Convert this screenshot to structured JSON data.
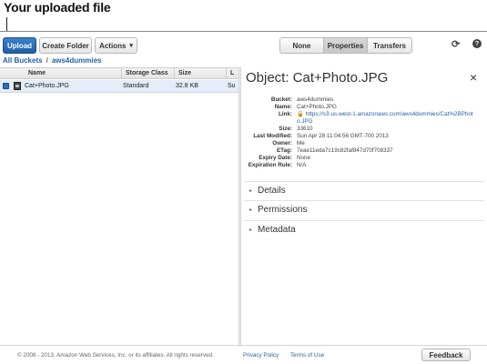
{
  "callout": {
    "text": "Your uploaded file"
  },
  "toolbar": {
    "upload_label": "Upload",
    "create_folder_label": "Create Folder",
    "actions_label": "Actions",
    "views": [
      "None",
      "Properties",
      "Transfers"
    ],
    "active_view": "Properties",
    "refresh_icon": "refresh-icon",
    "help_icon": "help-icon"
  },
  "breadcrumb": {
    "root": "All Buckets",
    "separator": "/",
    "current": "aws4dummies"
  },
  "table": {
    "headers": {
      "name": "Name",
      "storage_class": "Storage Class",
      "size": "Size",
      "last": "L"
    },
    "rows": [
      {
        "name": "Cat+Photo.JPG",
        "storage_class": "Standard",
        "size": "32.8 KB",
        "last": "Su",
        "selected": true
      }
    ]
  },
  "properties": {
    "title": "Object: Cat+Photo.JPG",
    "close": "×",
    "fields": {
      "bucket": {
        "label": "Bucket:",
        "value": "aws4dummies"
      },
      "name": {
        "label": "Name:",
        "value": "Cat+Photo.JPG"
      },
      "link": {
        "label": "Link:",
        "line1": "https://s3-us-west-1.amazonaws.com/aws4dummies/Cat%2BPhot",
        "line2": "o.JPG"
      },
      "size": {
        "label": "Size:",
        "value": "33610"
      },
      "last_modified": {
        "label": "Last Modified:",
        "value": "Sun Apr 28 11:04:56 GMT-700 2013"
      },
      "owner": {
        "label": "Owner:",
        "value": "Me"
      },
      "etag": {
        "label": "ETag:",
        "value": "7eae11eda7c19c82faf847d70f708337"
      },
      "expiry_date": {
        "label": "Expiry Date:",
        "value": "None"
      },
      "expiration_rule": {
        "label": "Expiration Rule:",
        "value": "N/A"
      }
    },
    "sections": [
      "Details",
      "Permissions",
      "Metadata"
    ]
  },
  "footer": {
    "copyright": "© 2008 - 2013, Amazon Web Services, Inc. or its affiliates. All rights reserved.",
    "privacy": "Privacy Policy",
    "terms": "Terms of Use",
    "feedback": "Feedback"
  },
  "colors": {
    "accent": "#2463a8",
    "primary_button": "#2a6fb8",
    "selected_row": "#e3ecf7"
  }
}
